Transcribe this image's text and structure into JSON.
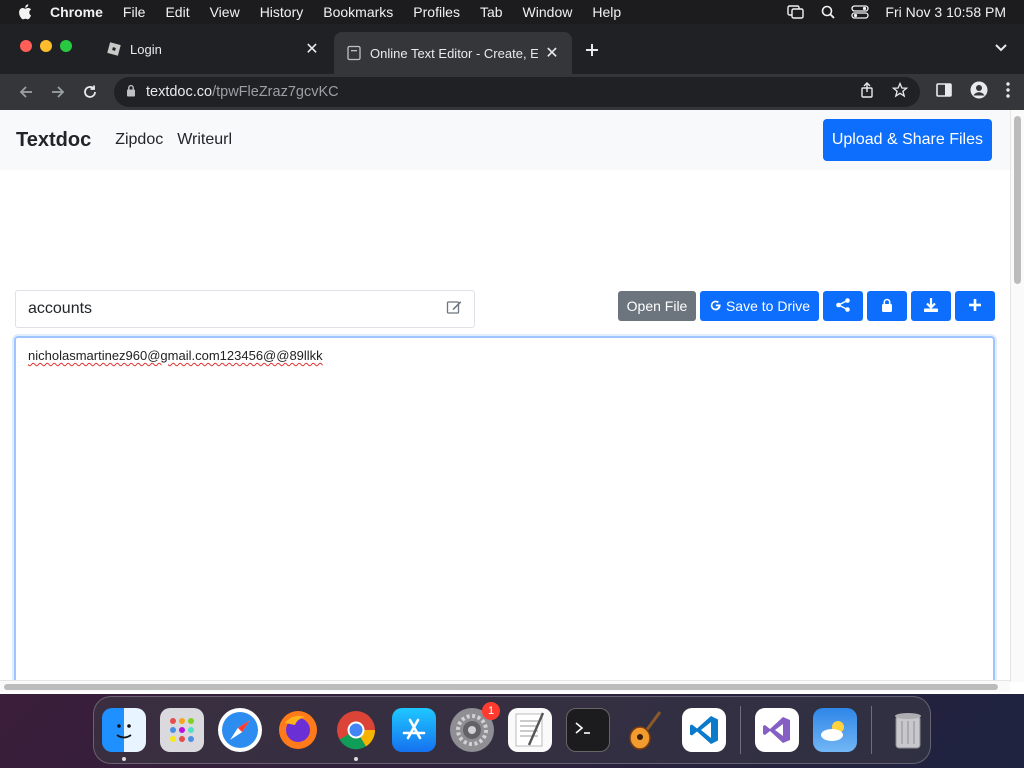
{
  "menubar": {
    "app_name": "Chrome",
    "items": [
      "File",
      "Edit",
      "View",
      "History",
      "Bookmarks",
      "Profiles",
      "Tab",
      "Window",
      "Help"
    ],
    "datetime": "Fri Nov 3  10:58 PM"
  },
  "browser": {
    "tabs": [
      {
        "title": "Login",
        "active": false
      },
      {
        "title": "Online Text Editor - Create, Edit",
        "active": true
      }
    ],
    "url_host": "textdoc.co",
    "url_path": "/tpwFleZraz7gcvKC"
  },
  "site": {
    "brand": "Textdoc",
    "nav_links": [
      "Zipdoc",
      "Writeurl"
    ],
    "upload_button": "Upload & Share Files",
    "document_name": "accounts",
    "open_file_button": "Open File",
    "save_drive_button": "Save to Drive",
    "editor_content": "nicholasmartinez960@gmail.com123456@@89llkk",
    "accent_color": "#0d6efd"
  },
  "dock": {
    "apps": [
      "Finder",
      "Launchpad",
      "Safari",
      "Firefox",
      "Google Chrome",
      "App Store",
      "System Preferences",
      "TextEdit",
      "Terminal",
      "GarageBand",
      "Visual Studio Code",
      "Visual Studio",
      "Weather",
      "Trash"
    ],
    "system_preferences_badge": "1"
  }
}
